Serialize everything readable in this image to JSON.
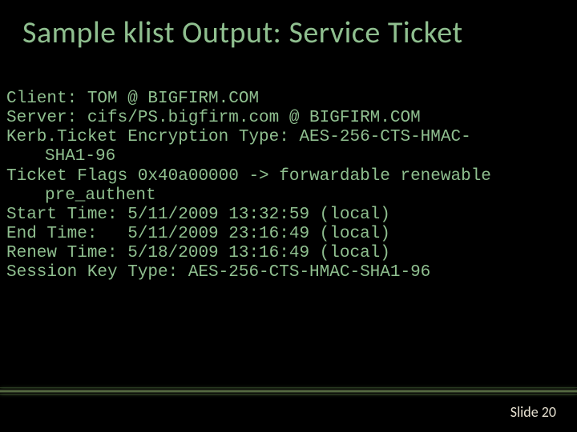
{
  "title": "Sample klist Output: Service Ticket",
  "lines": {
    "l1": "Client: TOM @ BIGFIRM.COM",
    "l2": "Server: cifs/PS.bigfirm.com @ BIGFIRM.COM",
    "l3": "Kerb.Ticket Encryption Type: AES-256-CTS-HMAC-",
    "l3b": "SHA1-96",
    "l4": "Ticket Flags 0x40a00000 -> forwardable renewable",
    "l4b": "pre_authent",
    "l5": "Start Time: 5/11/2009 13:32:59 (local)",
    "l6": "End Time:   5/11/2009 23:16:49 (local)",
    "l7": "Renew Time: 5/18/2009 13:16:49 (local)",
    "l8": "Session Key Type: AES-256-CTS-HMAC-SHA1-96"
  },
  "footer": {
    "slide_label": "Slide 20"
  }
}
